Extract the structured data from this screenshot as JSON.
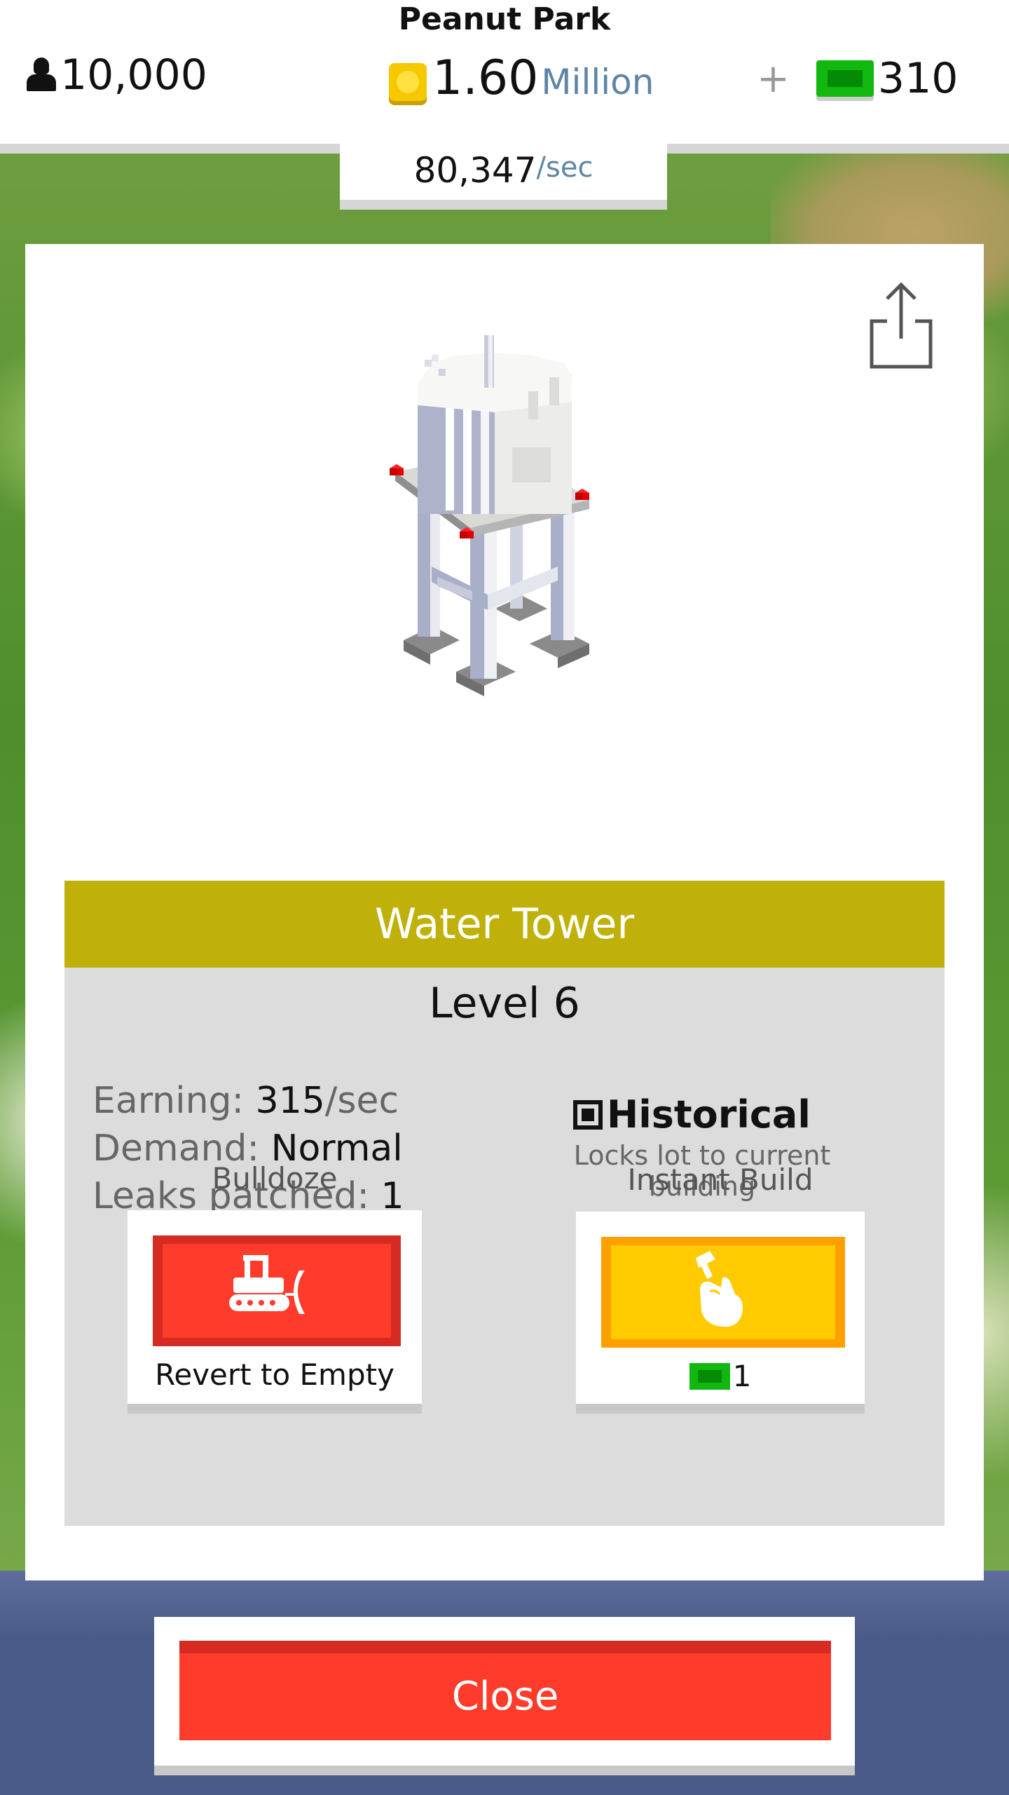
{
  "header": {
    "park_name": "Peanut Park",
    "population": "10,000",
    "money_value": "1.60",
    "money_unit": "Million",
    "plus": "+",
    "cash": "310",
    "rate_value": "80,347",
    "rate_unit": "/sec"
  },
  "building": {
    "name": "Water Tower",
    "level": "Level 6",
    "earning_label": "Earning: ",
    "earning_value": "315",
    "earning_unit": "/sec",
    "demand_label": "Demand: ",
    "demand_value": "Normal",
    "leaks_label": "Leaks patched: ",
    "leaks_value": "1",
    "historical_label": "Historical",
    "historical_sub": "Locks lot to current building",
    "historical_checked": true
  },
  "actions": {
    "bulldoze_label": "Bulldoze",
    "bulldoze_sub": "Revert to Empty",
    "instant_label": "Instant Build",
    "instant_cost": "1"
  },
  "footer": {
    "close_label": "Close"
  },
  "colors": {
    "title_band": "#bfb10a",
    "bulldoze": "#ff3b2b",
    "instant": "#ffcb00",
    "close": "#ff3b2b",
    "cash_green": "#10b810",
    "coin_gold": "#f5c800"
  },
  "icons": [
    "person-icon",
    "coin-icon",
    "cash-icon",
    "share-icon",
    "bulldozer-icon",
    "hammer-hand-icon",
    "checkbox-icon"
  ]
}
